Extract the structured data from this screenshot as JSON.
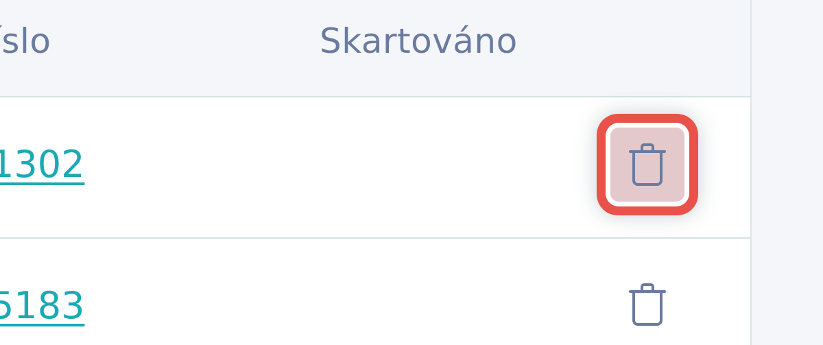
{
  "table": {
    "columns": {
      "cislo": "íslo",
      "skartovano": "Skartováno"
    },
    "rows": [
      {
        "cislo": "1302",
        "skartovano": "",
        "action_icon": "trash-icon"
      },
      {
        "cislo": "5183",
        "skartovano": "",
        "action_icon": "trash-icon"
      }
    ]
  },
  "colors": {
    "link": "#19aab5",
    "header_text": "#6a7b9f",
    "highlight": "#e8524a",
    "icon": "#6a7b9f"
  }
}
